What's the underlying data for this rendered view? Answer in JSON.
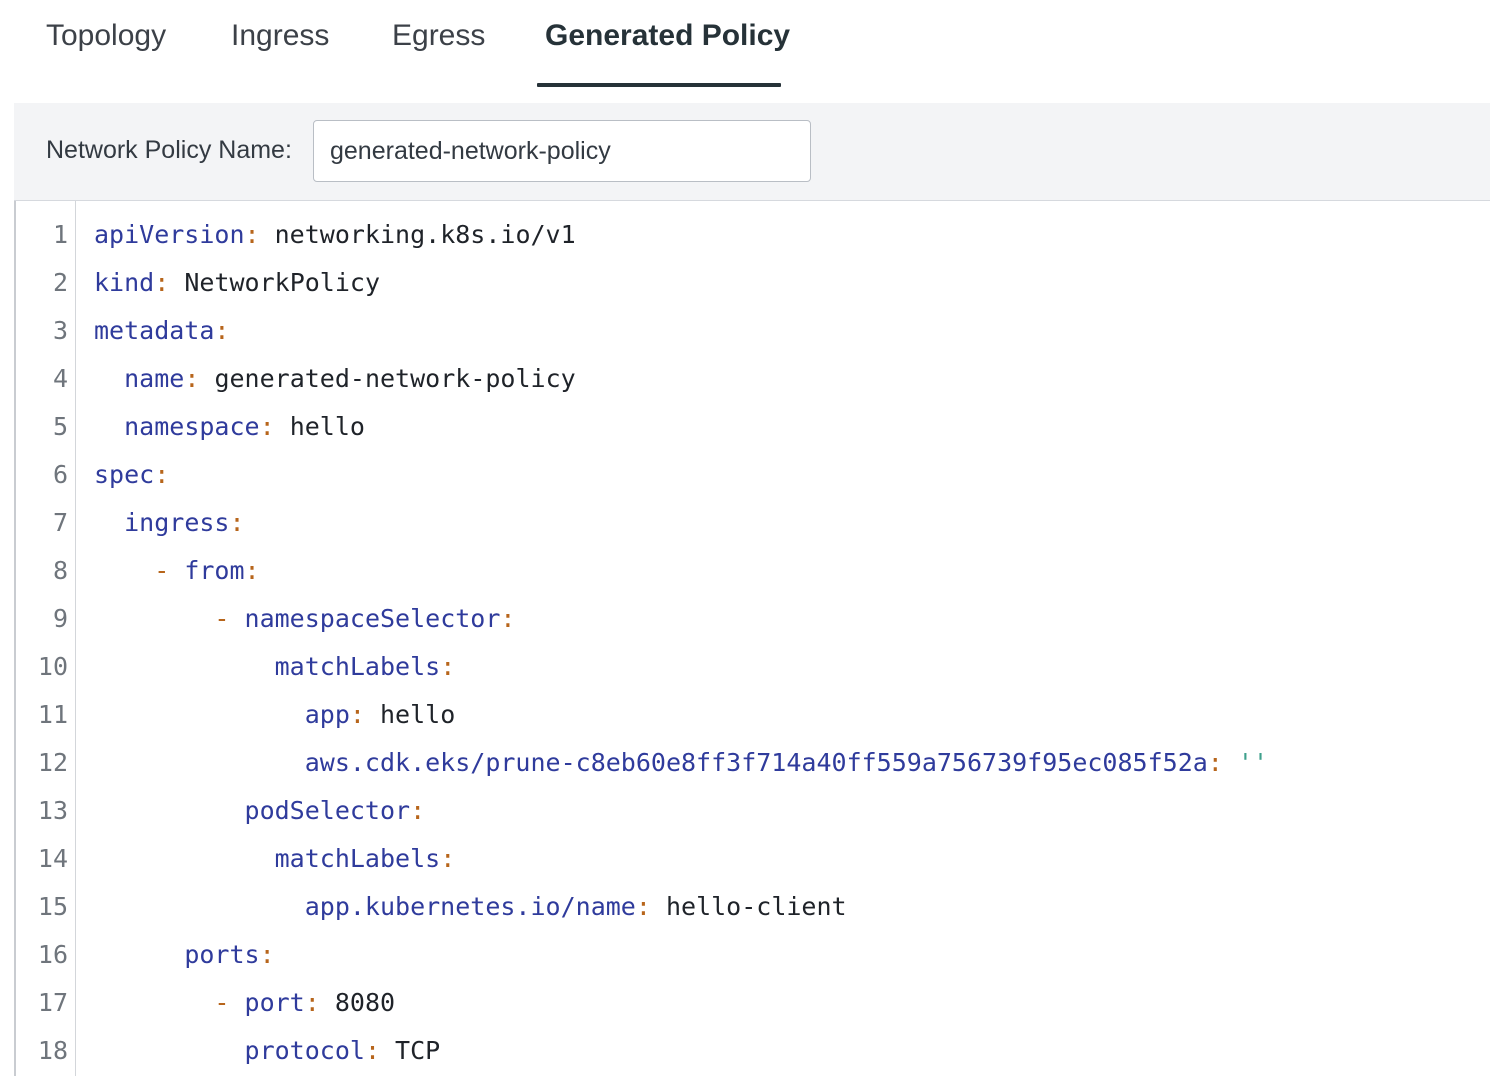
{
  "tabs": [
    {
      "label": "Topology",
      "active": false
    },
    {
      "label": "Ingress",
      "active": false
    },
    {
      "label": "Egress",
      "active": false
    },
    {
      "label": "Generated Policy",
      "active": true
    }
  ],
  "policy_name": {
    "label": "Network Policy Name:",
    "value": "generated-network-policy"
  },
  "editor": {
    "lines": [
      {
        "num": "1",
        "indent": "",
        "dash": "",
        "key": "apiVersion",
        "colon": ":",
        "value": " networking.k8s.io/v1",
        "str": ""
      },
      {
        "num": "2",
        "indent": "",
        "dash": "",
        "key": "kind",
        "colon": ":",
        "value": " NetworkPolicy",
        "str": ""
      },
      {
        "num": "3",
        "indent": "",
        "dash": "",
        "key": "metadata",
        "colon": ":",
        "value": "",
        "str": ""
      },
      {
        "num": "4",
        "indent": "  ",
        "dash": "",
        "key": "name",
        "colon": ":",
        "value": " generated-network-policy",
        "str": ""
      },
      {
        "num": "5",
        "indent": "  ",
        "dash": "",
        "key": "namespace",
        "colon": ":",
        "value": " hello",
        "str": ""
      },
      {
        "num": "6",
        "indent": "",
        "dash": "",
        "key": "spec",
        "colon": ":",
        "value": "",
        "str": ""
      },
      {
        "num": "7",
        "indent": "  ",
        "dash": "",
        "key": "ingress",
        "colon": ":",
        "value": "",
        "str": ""
      },
      {
        "num": "8",
        "indent": "    ",
        "dash": "- ",
        "key": "from",
        "colon": ":",
        "value": "",
        "str": ""
      },
      {
        "num": "9",
        "indent": "        ",
        "dash": "- ",
        "key": "namespaceSelector",
        "colon": ":",
        "value": "",
        "str": ""
      },
      {
        "num": "10",
        "indent": "            ",
        "dash": "",
        "key": "matchLabels",
        "colon": ":",
        "value": "",
        "str": ""
      },
      {
        "num": "11",
        "indent": "              ",
        "dash": "",
        "key": "app",
        "colon": ":",
        "value": " hello",
        "str": ""
      },
      {
        "num": "12",
        "indent": "              ",
        "dash": "",
        "key": "aws.cdk.eks/prune-c8eb60e8ff3f714a40ff559a756739f95ec085f52a",
        "colon": ":",
        "value": " ",
        "str": "''"
      },
      {
        "num": "13",
        "indent": "          ",
        "dash": "",
        "key": "podSelector",
        "colon": ":",
        "value": "",
        "str": ""
      },
      {
        "num": "14",
        "indent": "            ",
        "dash": "",
        "key": "matchLabels",
        "colon": ":",
        "value": "",
        "str": ""
      },
      {
        "num": "15",
        "indent": "              ",
        "dash": "",
        "key": "app.kubernetes.io/name",
        "colon": ":",
        "value": " hello-client",
        "str": ""
      },
      {
        "num": "16",
        "indent": "      ",
        "dash": "",
        "key": "ports",
        "colon": ":",
        "value": "",
        "str": ""
      },
      {
        "num": "17",
        "indent": "        ",
        "dash": "- ",
        "key": "port",
        "colon": ":",
        "value": " 8080",
        "str": ""
      },
      {
        "num": "18",
        "indent": "          ",
        "dash": "",
        "key": "protocol",
        "colon": ":",
        "value": " TCP",
        "str": ""
      }
    ]
  }
}
